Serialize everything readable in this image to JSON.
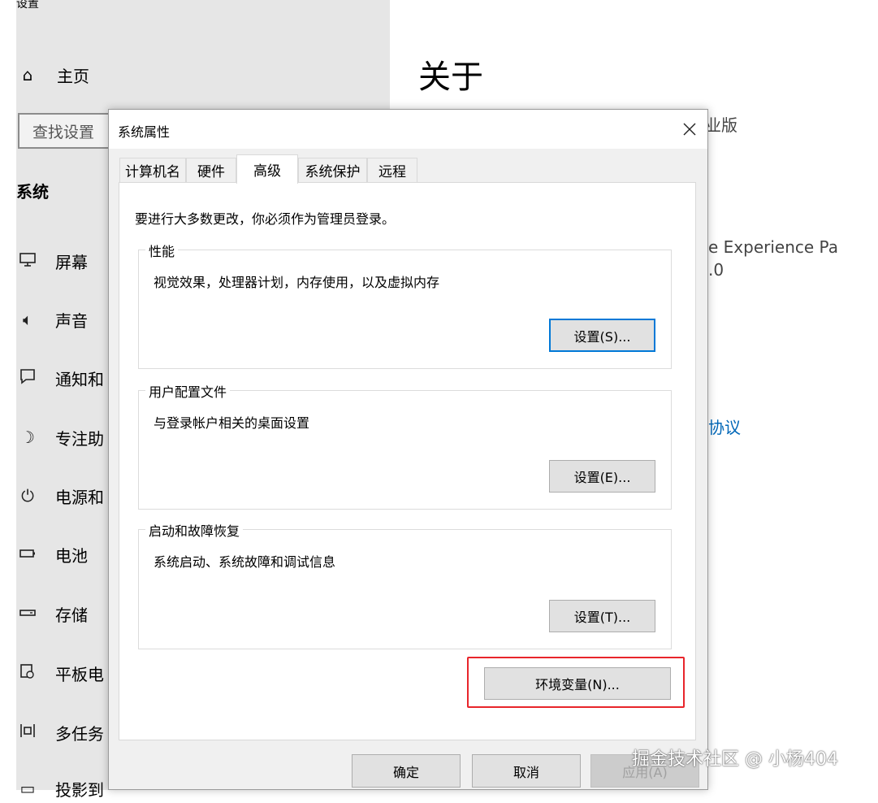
{
  "settings": {
    "window_title": "设置",
    "home_label": "主页",
    "search_placeholder": "查找设置",
    "section": "系统",
    "nav": [
      {
        "icon": "monitor-icon",
        "label": "屏幕"
      },
      {
        "icon": "speaker-icon",
        "label": "声音"
      },
      {
        "icon": "notification-icon",
        "label": "通知和"
      },
      {
        "icon": "focus-assist-icon",
        "label": "专注助"
      },
      {
        "icon": "power-icon",
        "label": "电源和"
      },
      {
        "icon": "battery-icon",
        "label": "电池"
      },
      {
        "icon": "storage-icon",
        "label": "存储"
      },
      {
        "icon": "tablet-icon",
        "label": "平板电"
      },
      {
        "icon": "multitasking-icon",
        "label": "多任务"
      },
      {
        "icon": "projecting-icon",
        "label": "投影到"
      }
    ],
    "about_title": "关于",
    "right_fragments": {
      "edition": "业版",
      "experience": "e Experience Pa",
      "version": ".0",
      "agreement_link": "协议"
    }
  },
  "dialog": {
    "title": "系统属性",
    "tabs": [
      "计算机名",
      "硬件",
      "高级",
      "系统保护",
      "远程"
    ],
    "active_tab": "高级",
    "intro": "要进行大多数更改，你必须作为管理员登录。",
    "groups": [
      {
        "title": "性能",
        "desc": "视觉效果，处理器计划，内存使用，以及虚拟内存",
        "button": "设置(S)..."
      },
      {
        "title": "用户配置文件",
        "desc": "与登录帐户相关的桌面设置",
        "button": "设置(E)..."
      },
      {
        "title": "启动和故障恢复",
        "desc": "系统启动、系统故障和调试信息",
        "button": "设置(T)..."
      }
    ],
    "env_button": "环境变量(N)...",
    "ok": "确定",
    "cancel": "取消",
    "apply": "应用(A)"
  },
  "watermark": "掘金技术社区 @ 小杨404",
  "colors": {
    "accent": "#0078d7",
    "highlight_border": "#e8252b",
    "link": "#0067b8"
  }
}
